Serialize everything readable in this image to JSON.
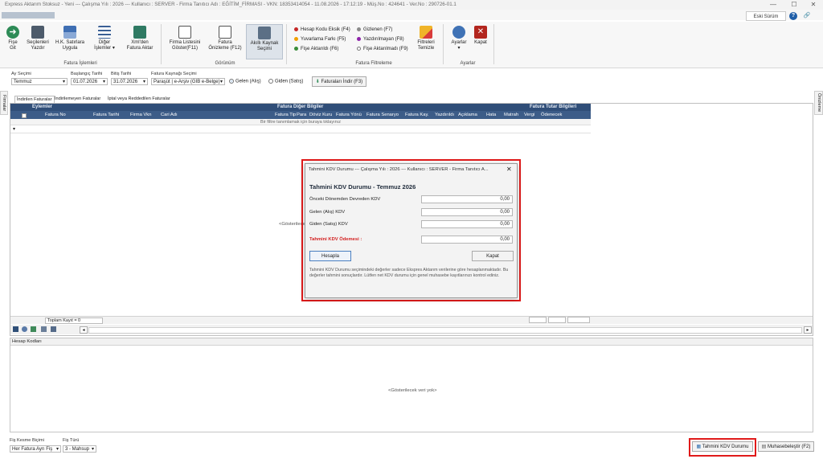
{
  "window": {
    "title": "Express Aktarım Stoksuz - Yeni  ---  Çalışma Yılı : 2026  ---  Kullanıcı : SERVER - Firma Tanıtıcı Adı : EĞİTİM_FİRMASI - VKN: 18353414054 - 11.08.2026 - 17:12:19 - Müş.No : 424641 - Ver.No : 290726-01.1",
    "minimize": "—",
    "maximize": "☐",
    "close": "✕"
  },
  "header": {
    "version_button": "Eski Sürüm",
    "help": "?",
    "link": "🔗"
  },
  "ribbon": {
    "buttons": [
      {
        "l1": "Fişe",
        "l2": "Git"
      },
      {
        "l1": "Seçilenleri",
        "l2": "Yazdır"
      },
      {
        "l1": "H.K. Satırlara",
        "l2": "Uygula"
      },
      {
        "l1": "Diğer",
        "l2": "İşlemler ▾"
      },
      {
        "l1": "Xml'den",
        "l2": "Fatura Aktar"
      },
      {
        "l1": "Firma Listesini",
        "l2": "Göster(F11)"
      },
      {
        "l1": "Fatura",
        "l2": "Önizleme (F12)"
      },
      {
        "l1": "Akıllı Kaynak",
        "l2": "Seçimi"
      },
      {
        "l1": "Filtreleri",
        "l2": "Temizle"
      },
      {
        "l1": "Ayarlar",
        "l2": "▾"
      },
      {
        "l1": "Kapat",
        "l2": ""
      }
    ],
    "groups": {
      "fatura_islemleri": "Fatura İşlemleri",
      "gorunum": "Görünüm",
      "fatura_filtreleme": "Fatura Filtreleme",
      "ayarlar": "Ayarlar"
    },
    "filters": [
      {
        "label": "Hesap Kodu Eksik (F4)",
        "color": "#c62828"
      },
      {
        "label": "Yuvarlama Farkı (F5)",
        "color": "#f0a000"
      },
      {
        "label": "Fişe Aktarıldı (F6)",
        "color": "#3a8d3a"
      },
      {
        "label": "Gizlenen (F7)",
        "color": "#8a8a8a"
      },
      {
        "label": "Yazdırılmayan (F8)",
        "color": "#8e24aa"
      },
      {
        "label": "Fişe Aktarılmadı (F9)",
        "color": "#ffffff"
      }
    ]
  },
  "params": {
    "ay_label": "Ay Seçimi",
    "ay_value": "Temmuz",
    "baslangic_label": "Başlangıç Tarihi",
    "baslangic_value": "01.07.2026",
    "bitis_label": "Bitiş Tarihi",
    "bitis_value": "31.07.2026",
    "kaynak_label": "Fatura Kaynağı Seçimi",
    "kaynak_value": "Paraşüt | e-Arşiv (GİB e-Belge)",
    "radio_gelen": "Gelen (Alış)",
    "radio_giden": "Giden (Satış)",
    "indir_button": "Faturaları İndir (F3)"
  },
  "side": {
    "left": "Firmalar",
    "right": "Önizleme"
  },
  "tabs": [
    "İndirilen Faturalar",
    "İndirilemeyen Faturalar",
    "İptal veya Reddedilen Faturalar"
  ],
  "grid": {
    "band1": "Eylemler",
    "band2": "Fatura Diğer Bilgiler",
    "band3": "Fatura Tutar Bilgileri",
    "columns": [
      "Fatura No",
      "Fatura Tarihi",
      "Firma Vkn",
      "Cari Adı",
      "Fatura Tip",
      "Para",
      "Döviz Kuru",
      "Fatura Yönü",
      "Fatura Senaryo",
      "Fatura Kay.",
      "Yazdırıldı",
      "Açıklama",
      "Hata",
      "Matrah",
      "Vergi",
      "Ödenecek"
    ],
    "filter_hint": "Bir filtre tanımlamak için buraya tıklayınız",
    "empty": "<Gösterilecek veri yok>",
    "total": "Toplam Kayıt = 0"
  },
  "hesap": {
    "title": "Hesap Kodları",
    "empty": "<Gösterilecek veri yok>"
  },
  "footer": {
    "kesme_label": "Fiş Kesme Biçimi",
    "kesme_value": "Her Fatura Ayrı Fiş",
    "tur_label": "Fiş Türü",
    "tur_value": "3 - Mahsup",
    "kdv_button": "Tahmini KDV Durumu",
    "muh_button": "Muhasebeleştir (F2)"
  },
  "dialog": {
    "title": "Tahmini KDV Durumu  ---  Çalışma Yılı : 2026  ---  Kullanıcı : SERVER - Firma Tanıtıcı A...",
    "close": "✕",
    "heading": "Tahmini KDV Durumu - Temmuz 2026",
    "rows": [
      {
        "label": "Önceki Dönemden Devreden KDV",
        "value": "0,00"
      },
      {
        "label": "Gelen (Alış) KDV",
        "value": "0,00"
      },
      {
        "label": "Giden (Satış) KDV",
        "value": "0,00"
      }
    ],
    "odeme_label": "Tahmini KDV Ödemesi :",
    "odeme_value": "0,00",
    "hesapla": "Hesapla",
    "kapat": "Kapat",
    "note": "Tahmini KDV Durumu seçimindeki değerler sadece Ekspres Aktarım verilerine göre hesaplanmaktadır. Bu değerler tahmini sonuçlardır. Lütfen net KDV durumu için genel muhasebe kayıtlarınızı kontrol ediniz."
  }
}
